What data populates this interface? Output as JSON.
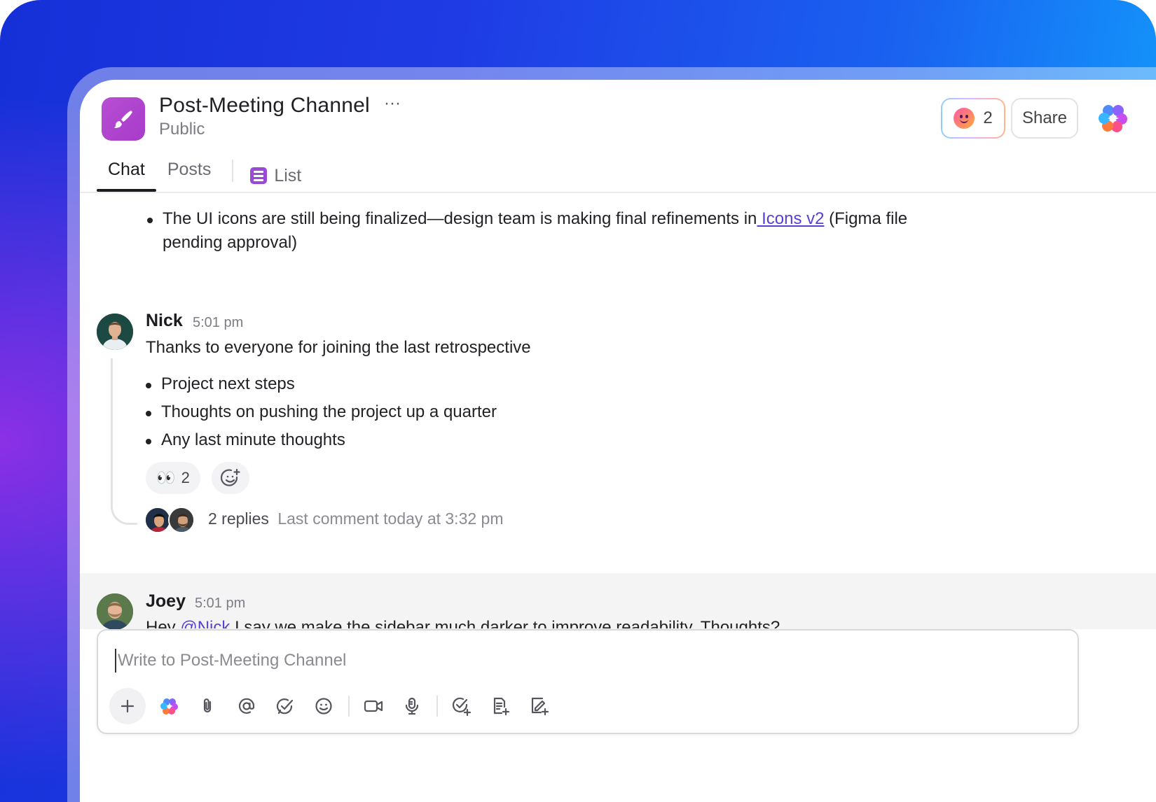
{
  "channel": {
    "title": "Post-Meeting Channel",
    "visibility": "Public",
    "icon": "paintbrush-icon",
    "accent": "#b04bd1"
  },
  "header": {
    "reaction_count": "2",
    "share_label": "Share",
    "more_label": "···"
  },
  "tabs": [
    {
      "label": "Chat",
      "active": true
    },
    {
      "label": "Posts",
      "active": false
    },
    {
      "label": "List",
      "active": false,
      "icon": "list-icon"
    }
  ],
  "previous_message": {
    "bullet_before_link": "The UI icons are still being finalized—design team is making final refinements in",
    "link_text": " Icons v2",
    "bullet_after_link": " (Figma file",
    "bullet_line2": "pending approval)"
  },
  "messages": [
    {
      "author": "Nick",
      "time": "5:01 pm",
      "text": "Thanks to everyone for joining the last retrospective",
      "bullets": [
        "Project next steps",
        "Thoughts on pushing the project up a quarter",
        "Any last minute thoughts"
      ],
      "reaction": {
        "emoji": "👀",
        "count": "2"
      },
      "replies": {
        "count_label": "2 replies",
        "last_comment": "Last comment today at 3:32 pm"
      }
    },
    {
      "author": "Joey",
      "time": "5:01 pm",
      "text_before_mention": "Hey ",
      "mention": "@Nick",
      "text_after_mention": " I say we make the sidebar much darker to improve readability. Thoughts?"
    }
  ],
  "composer": {
    "placeholder": "Write to Post-Meeting Channel",
    "tools": [
      "plus-icon",
      "ai-brain-icon",
      "attachment-icon",
      "mention-icon",
      "checkmark-bubble-icon",
      "emoji-icon",
      "video-icon",
      "microphone-icon",
      "add-task-icon",
      "add-doc-icon",
      "whiteboard-icon"
    ]
  }
}
